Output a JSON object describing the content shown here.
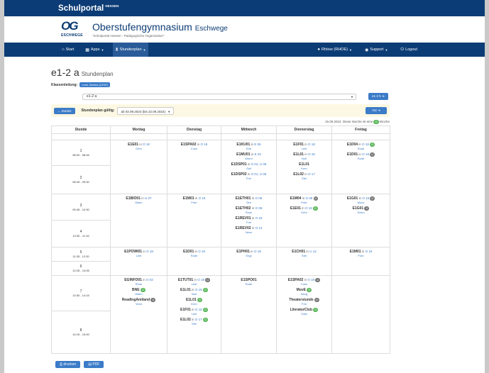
{
  "portal": {
    "title": "Schulportal",
    "sup": "HESSEN"
  },
  "school": {
    "logo_letters": "OG",
    "logo_sub": "ESCHWEGE",
    "name": "Oberstufengymnasium",
    "name_sub": "Eschwege",
    "tagline": "\"Schulportal Hessen - Pädagogische Organisation\""
  },
  "nav": {
    "start": "Start",
    "apps": "Apps",
    "stundenplan": "Stundenplan",
    "user": "Rhöse (RHOE)",
    "support": "Support",
    "logout": "Logout"
  },
  "title": {
    "main": "e1-2 a",
    "sub": "Stundenplan"
  },
  "klassenleitung": {
    "label": "Klassenleitung:",
    "value": "Lenk, Marina (LENT)"
  },
  "class_select": {
    "value": "e1-2 a",
    "next_label": "e1-2 b"
  },
  "gueltig": {
    "back": "Zurück",
    "label": "Stundenplan gültig:",
    "value": "ab 02.09.2024 (bis 22.09.2024)",
    "next": "Vor"
  },
  "legend": {
    "date": "15.09.2024",
    "text": "Diese Woche ist eine",
    "badge": "G",
    "suffix": "-Woche"
  },
  "columns": {
    "stunde": "Stunde",
    "days": [
      "Montag",
      "Dienstag",
      "Mittwoch",
      "Donnerstag",
      "Freitag"
    ]
  },
  "periods": [
    {
      "n": "1",
      "t": "08:00 - 08:45"
    },
    {
      "n": "2",
      "t": "08:45 - 09:30"
    },
    {
      "n": "3",
      "t": "09:45 - 10:30"
    },
    {
      "n": "4",
      "t": "10:30 - 11:15"
    },
    {
      "n": "5",
      "t": "11:35 - 12:20"
    },
    {
      "n": "6",
      "t": "12:25 - 13:05"
    },
    {
      "n": "7",
      "t": "13:30 - 14:15"
    },
    {
      "n": "8",
      "t": "14:15 - 15:00"
    }
  ],
  "blocks": [
    [
      [
        {
          "c": "E1E01",
          "r": "O 18",
          "t": "Dehl"
        }
      ],
      [
        {
          "c": "E1SPA02",
          "r": "O 19",
          "t": "Coen"
        }
      ],
      [
        {
          "c": "E1KU01",
          "r": "E 06",
          "t": "Erle"
        },
        {
          "c": "E1MU01",
          "r": "E 02",
          "t": "Worm"
        },
        {
          "c": "E1DSP01",
          "r": "O 04, U 05",
          "t": "Goll"
        },
        {
          "c": "E1DSP02",
          "r": "O 01, U 06",
          "t": "Frei"
        }
      ],
      [
        {
          "c": "E1F01",
          "r": "O 18",
          "t": "Lent"
        },
        {
          "c": "E1L01",
          "r": "O 18",
          "t": "Noll"
        },
        {
          "c": "E1L01",
          "r": "",
          "t": "Kren"
        },
        {
          "c": "E1L02",
          "r": "O 17",
          "t": "Stei"
        }
      ],
      [
        {
          "c": "E1D04",
          "r": "O 18",
          "t": "Rode",
          "b": "G"
        },
        {
          "c": "E1D01",
          "r": "O 18",
          "t": "Rode",
          "b": "U"
        }
      ]
    ],
    [
      [
        {
          "c": "E1BIO01",
          "r": "U 07",
          "t": "Wahn"
        }
      ],
      [
        {
          "c": "E1M01",
          "r": "O 19",
          "t": "Pohr"
        }
      ],
      [
        {
          "c": "E1ETH01",
          "r": "O 09",
          "t": "Sior"
        },
        {
          "c": "E1ETH02",
          "r": "O 08",
          "t": "Roch"
        },
        {
          "c": "E1REV01",
          "r": "O 18",
          "t": "Frei"
        },
        {
          "c": "E1REV02",
          "r": "O 13",
          "t": "Neun"
        }
      ],
      [
        {
          "c": "E1M04",
          "r": "O 09",
          "t": "Pohr",
          "b": "U"
        },
        {
          "c": "E1E01",
          "r": "O 19",
          "t": "Dehl",
          "b": "G"
        }
      ],
      [
        {
          "c": "E1G01",
          "r": "O 18",
          "t": "Mooz",
          "b": "U"
        },
        {
          "c": "E1G01",
          "r": "",
          "t": "Schm",
          "b": "U"
        }
      ]
    ],
    [
      [
        {
          "c": "E1POWI01",
          "r": "O 18",
          "t": "Lent"
        }
      ],
      [
        {
          "c": "E1D01",
          "r": "O 18",
          "t": "Rode"
        }
      ],
      [
        {
          "c": "E1PH01",
          "r": "O 18",
          "t": "Engl"
        }
      ],
      [
        {
          "c": "E1CH01",
          "r": "U 12",
          "t": "Stei"
        }
      ],
      [
        {
          "c": "E1M01",
          "r": "O 18",
          "t": "Pohr"
        }
      ]
    ],
    [
      [
        {
          "c": "EGINFO01",
          "r": "O 02",
          "t": "Rhoe"
        },
        {
          "c": "BNE",
          "r": "",
          "t": "Wahn",
          "b": "G"
        },
        {
          "c": "ReadingAmiland",
          "r": "",
          "t": "Vene",
          "b": "U"
        }
      ],
      [
        {
          "c": "E1TUT01",
          "r": "O 18",
          "t": "Lent",
          "b": "U"
        },
        {
          "c": "E1L01",
          "r": "O 18",
          "t": "Noll",
          "b": "G"
        },
        {
          "c": "E1L01",
          "r": "",
          "t": "Kren",
          "b": "G"
        },
        {
          "c": "E1F01",
          "r": "O 18",
          "t": "Lent",
          "b": "G"
        },
        {
          "c": "E1L02",
          "r": "O 17",
          "t": "Stei",
          "b": "G"
        }
      ],
      [
        {
          "c": "E1SPO01",
          "r": "",
          "t": "Rode"
        }
      ],
      [
        {
          "c": "E1SPA02",
          "r": "O 19",
          "t": "Coen",
          "b": "U"
        },
        {
          "c": "MovE",
          "r": "",
          "t": "Neug",
          "b": "G"
        },
        {
          "c": "Theaterstunde",
          "r": "",
          "t": "Frei",
          "b": "U"
        },
        {
          "c": "LiteraturClub",
          "r": "",
          "t": "Gabi",
          "b": "G"
        }
      ],
      []
    ]
  ],
  "buttons": {
    "print": "drucken",
    "pdf": "PDF"
  },
  "colors": {
    "nav": "#0c3c75",
    "accent": "#3b7bc8",
    "green_badge": "#5cb85c",
    "gray_badge": "#777777",
    "info_bar": "#fcf8e3"
  }
}
